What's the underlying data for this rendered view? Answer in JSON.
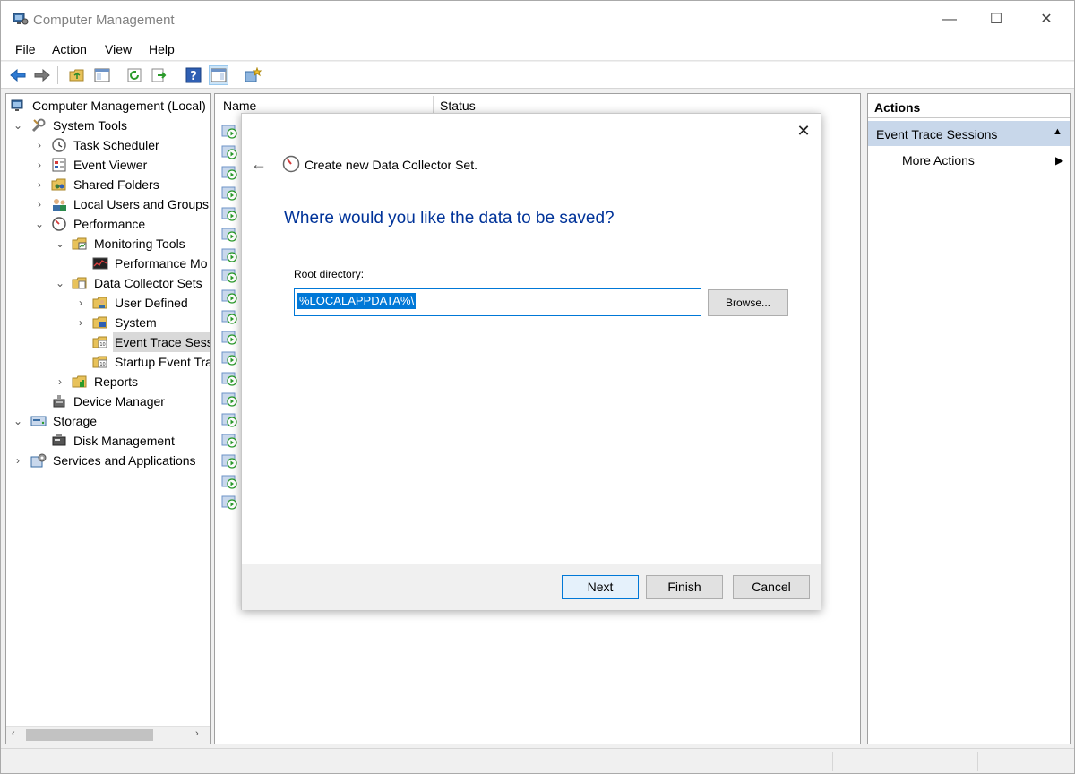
{
  "window": {
    "title": "Computer Management",
    "controls": {
      "minimize": "—",
      "maximize": "☐",
      "close": "✕"
    }
  },
  "menu": [
    "File",
    "Action",
    "View",
    "Help"
  ],
  "tree": {
    "items": [
      {
        "label": "Computer Management (Local)"
      },
      {
        "label": "System Tools"
      },
      {
        "label": "Task Scheduler"
      },
      {
        "label": "Event Viewer"
      },
      {
        "label": "Shared Folders"
      },
      {
        "label": "Local Users and Groups"
      },
      {
        "label": "Performance"
      },
      {
        "label": "Monitoring Tools"
      },
      {
        "label": "Performance Mo"
      },
      {
        "label": "Data Collector Sets"
      },
      {
        "label": "User Defined"
      },
      {
        "label": "System"
      },
      {
        "label": "Event Trace Sessi"
      },
      {
        "label": "Startup Event Tra"
      },
      {
        "label": "Reports"
      },
      {
        "label": "Device Manager"
      },
      {
        "label": "Storage"
      },
      {
        "label": "Disk Management"
      },
      {
        "label": "Services and Applications"
      }
    ]
  },
  "list": {
    "columns": [
      "Name",
      "Status"
    ],
    "row_count": 19
  },
  "actions": {
    "header": "Actions",
    "section": "Event Trace Sessions",
    "item": "More Actions"
  },
  "dialog": {
    "title": "Create new Data Collector Set.",
    "heading": "Where would you like the data to be saved?",
    "root_label": "Root directory:",
    "root_value": "%LOCALAPPDATA%\\",
    "browse": "Browse...",
    "next": "Next",
    "finish": "Finish",
    "cancel": "Cancel"
  },
  "colors": {
    "accent": "#0078d7",
    "heading": "#003399",
    "action_section": "#c8d7ea"
  }
}
